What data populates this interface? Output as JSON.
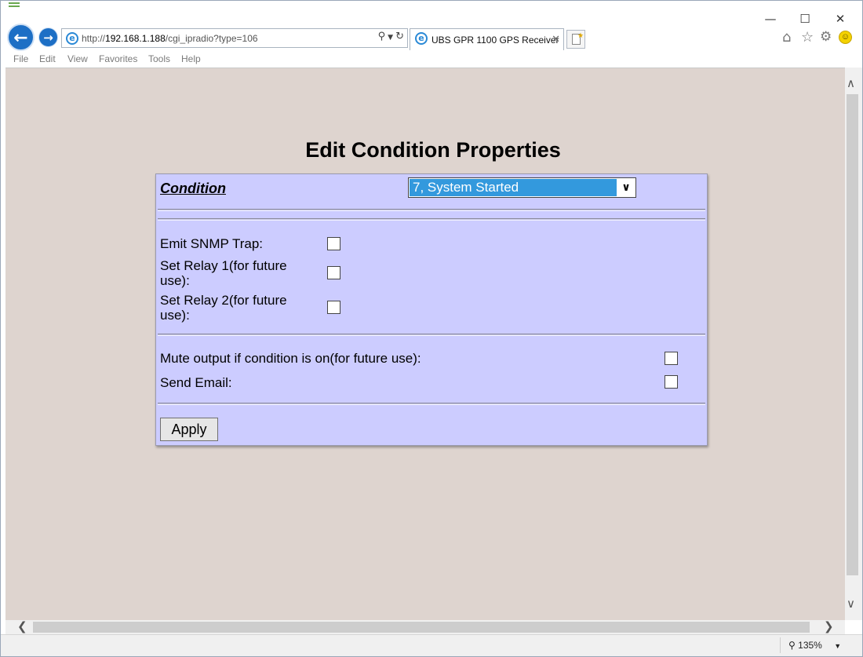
{
  "browser": {
    "address": {
      "prefix": "http://",
      "host": "192.168.1.188",
      "path": "/cgi_ipradio?type=106"
    },
    "tab_title": "UBS GPR 1100 GPS Receiver",
    "menu": [
      "File",
      "Edit",
      "View",
      "Favorites",
      "Tools",
      "Help"
    ],
    "zoom": "135%"
  },
  "page": {
    "title": "Edit Condition Properties",
    "condition": {
      "label": "Condition",
      "selected": "7, System Started"
    },
    "options": [
      {
        "label_line1": "Emit SNMP Trap:",
        "label_line2": "",
        "checked": false
      },
      {
        "label_line1": "Set Relay 1(for future",
        "label_line2": "use):",
        "checked": false
      },
      {
        "label_line1": "Set Relay 2(for future",
        "label_line2": "use):",
        "checked": false
      },
      {
        "label_line1": "Mute output if condition is on(for future use):",
        "label_line2": "",
        "checked": false
      },
      {
        "label_line1": "Send Email:",
        "label_line2": "",
        "checked": false
      }
    ],
    "apply_label": "Apply"
  },
  "colors": {
    "panel": "#ccccff",
    "page_bg": "#ded4cf",
    "selection": "#3399dd",
    "nav_blue": "#1d6fc5"
  },
  "icons": [
    "back-arrow-icon",
    "forward-arrow-icon",
    "ie-logo-icon",
    "search-icon",
    "refresh-icon",
    "close-icon",
    "new-tab-icon",
    "home-icon",
    "favorites-star-icon",
    "gear-icon",
    "smiley-feedback-icon",
    "zoom-icon"
  ]
}
